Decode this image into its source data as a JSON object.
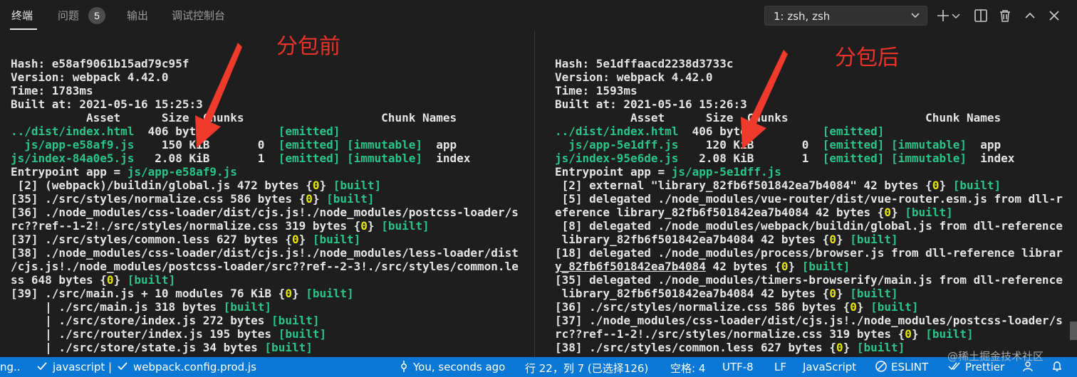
{
  "tabs": [
    {
      "label": "终端",
      "active": true
    },
    {
      "label": "问题"
    },
    {
      "label": "输出"
    },
    {
      "label": "调试控制台"
    }
  ],
  "problems_count": "5",
  "terminal_selector": {
    "value": "1: zsh, zsh"
  },
  "toolbar_icons": [
    "plus-icon",
    "chevron-down-icon",
    "split-icon",
    "trash-icon",
    "chevron-up-icon",
    "close-icon"
  ],
  "annotations": {
    "left": "分包前",
    "right": "分包后"
  },
  "colors": {
    "accent_red": "#e8332a",
    "status_bar": "#0a78d4",
    "green": "#2bc48a",
    "yellow": "#e5e510"
  },
  "left_lines": [
    [
      {
        "t": "Hash: ",
        "c": "w"
      },
      {
        "t": "e58af9061b15ad79c95f",
        "c": "w"
      }
    ],
    [
      {
        "t": "Version: webpack ",
        "c": "w"
      },
      {
        "t": "4.42.0",
        "c": "w"
      }
    ],
    [
      {
        "t": "Time: ",
        "c": "w"
      },
      {
        "t": "1783",
        "c": "w"
      },
      {
        "t": "ms",
        "c": "w"
      }
    ],
    [
      {
        "t": "Built at: 2021-05-16 ",
        "c": "w"
      },
      {
        "t": "15:25:3",
        "c": "w"
      }
    ],
    [
      {
        "t": "           Asset      Size  Chunks                    Chunk Names",
        "c": "w"
      }
    ],
    [
      {
        "t": "../dist/index.html",
        "c": "g"
      },
      {
        "t": "  406 bytes          ",
        "c": "w"
      },
      {
        "t": "[emitted]",
        "c": "g"
      }
    ],
    [
      {
        "t": "  js/app-e58af9.js",
        "c": "g"
      },
      {
        "t": "    150 KiB       0  ",
        "c": "w"
      },
      {
        "t": "[emitted] [immutable]",
        "c": "g"
      },
      {
        "t": "  app",
        "c": "w"
      }
    ],
    [
      {
        "t": "js/index-84a0e5.js",
        "c": "g"
      },
      {
        "t": "   2.08 KiB       1  ",
        "c": "w"
      },
      {
        "t": "[emitted] [immutable]",
        "c": "g"
      },
      {
        "t": "  index",
        "c": "w"
      }
    ],
    [
      {
        "t": "Entrypoint app = ",
        "c": "w"
      },
      {
        "t": "js/app-e58af9.js",
        "c": "g"
      }
    ],
    [
      {
        "t": " [2] (webpack)/buildin/global.js 472 bytes {",
        "c": "w"
      },
      {
        "t": "0",
        "c": "y"
      },
      {
        "t": "} ",
        "c": "w"
      },
      {
        "t": "[built]",
        "c": "g"
      }
    ],
    [
      {
        "t": "[35] ./src/styles/normalize.css 586 bytes {",
        "c": "w"
      },
      {
        "t": "0",
        "c": "y"
      },
      {
        "t": "} ",
        "c": "w"
      },
      {
        "t": "[built]",
        "c": "g"
      }
    ],
    [
      {
        "t": "[36] ./node_modules/css-loader/dist/cjs.js!./node_modules/postcss-loader/s",
        "c": "w"
      }
    ],
    [
      {
        "t": "rc??ref--1-2!./src/styles/normalize.css 319 bytes {",
        "c": "w"
      },
      {
        "t": "0",
        "c": "y"
      },
      {
        "t": "} ",
        "c": "w"
      },
      {
        "t": "[built]",
        "c": "g"
      }
    ],
    [
      {
        "t": "[37] ./src/styles/common.less 627 bytes {",
        "c": "w"
      },
      {
        "t": "0",
        "c": "y"
      },
      {
        "t": "} ",
        "c": "w"
      },
      {
        "t": "[built]",
        "c": "g"
      }
    ],
    [
      {
        "t": "[38] ./node_modules/css-loader/dist/cjs.js!./node_modules/less-loader/dist",
        "c": "w"
      }
    ],
    [
      {
        "t": "/cjs.js!./node_modules/postcss-loader/src??ref--2-3!./src/styles/common.le",
        "c": "w"
      }
    ],
    [
      {
        "t": "ss 648 bytes {",
        "c": "w"
      },
      {
        "t": "0",
        "c": "y"
      },
      {
        "t": "} ",
        "c": "w"
      },
      {
        "t": "[built]",
        "c": "g"
      }
    ],
    [
      {
        "t": "[39] ./src/main.js + 10 modules 76 KiB {",
        "c": "w"
      },
      {
        "t": "0",
        "c": "y"
      },
      {
        "t": "} ",
        "c": "w"
      },
      {
        "t": "[built]",
        "c": "g"
      }
    ],
    [
      {
        "t": "     | ./src/main.js 318 bytes ",
        "c": "w"
      },
      {
        "t": "[built]",
        "c": "g"
      }
    ],
    [
      {
        "t": "     | ./src/store/index.js 272 bytes ",
        "c": "w"
      },
      {
        "t": "[built]",
        "c": "g"
      }
    ],
    [
      {
        "t": "     | ./src/router/index.js 195 bytes ",
        "c": "w"
      },
      {
        "t": "[built]",
        "c": "g"
      }
    ],
    [
      {
        "t": "     | ./src/store/state.js 34 bytes ",
        "c": "w"
      },
      {
        "t": "[built]",
        "c": "g"
      }
    ]
  ],
  "right_lines": [
    [
      {
        "t": "Hash: ",
        "c": "w"
      },
      {
        "t": "5e1dffaacd2238d3733c",
        "c": "w"
      }
    ],
    [
      {
        "t": "Version: webpack ",
        "c": "w"
      },
      {
        "t": "4.42.0",
        "c": "w"
      }
    ],
    [
      {
        "t": "Time: ",
        "c": "w"
      },
      {
        "t": "1593",
        "c": "w"
      },
      {
        "t": "ms",
        "c": "w"
      }
    ],
    [
      {
        "t": "Built at: 2021-05-16 ",
        "c": "w"
      },
      {
        "t": "15:26:3",
        "c": "w"
      }
    ],
    [
      {
        "t": "           Asset      Size  Chunks                    Chunk Names",
        "c": "w"
      }
    ],
    [
      {
        "t": "../dist/index.html",
        "c": "g"
      },
      {
        "t": "  406 bytes          ",
        "c": "w"
      },
      {
        "t": "[emitted]",
        "c": "g"
      }
    ],
    [
      {
        "t": "  js/app-5e1dff.js",
        "c": "g"
      },
      {
        "t": "    120 KiB       0  ",
        "c": "w"
      },
      {
        "t": "[emitted] [immutable]",
        "c": "g"
      },
      {
        "t": "  app",
        "c": "w"
      }
    ],
    [
      {
        "t": "js/index-95e6de.js",
        "c": "g"
      },
      {
        "t": "   2.08 KiB       1  ",
        "c": "w"
      },
      {
        "t": "[emitted] [immutable]",
        "c": "g"
      },
      {
        "t": "  index",
        "c": "w"
      }
    ],
    [
      {
        "t": "Entrypoint app = ",
        "c": "w"
      },
      {
        "t": "js/app-5e1dff.js",
        "c": "g"
      }
    ],
    [
      {
        "t": " [2] external \"library_82fb6f501842ea7b4084\" 42 bytes {",
        "c": "w"
      },
      {
        "t": "0",
        "c": "y"
      },
      {
        "t": "} ",
        "c": "w"
      },
      {
        "t": "[built]",
        "c": "g"
      }
    ],
    [
      {
        "t": " [5] delegated ./node_modules/vue-router/dist/vue-router.esm.js from dll-r",
        "c": "w"
      }
    ],
    [
      {
        "t": "eference library_82fb6f501842ea7b4084 42 bytes {",
        "c": "w"
      },
      {
        "t": "0",
        "c": "y"
      },
      {
        "t": "} ",
        "c": "w"
      },
      {
        "t": "[built]",
        "c": "g"
      }
    ],
    [
      {
        "t": " [8] delegated ./node_modules/webpack/buildin/global.js from dll-reference",
        "c": "w"
      }
    ],
    [
      {
        "t": " library_82fb6f501842ea7b4084 42 bytes {",
        "c": "w"
      },
      {
        "t": "0",
        "c": "y"
      },
      {
        "t": "} ",
        "c": "w"
      },
      {
        "t": "[built]",
        "c": "g"
      }
    ],
    [
      {
        "t": "[18] delegated ./node_modules/process/browser.js from dll-reference librar",
        "c": "w"
      }
    ],
    [
      {
        "t": "y_82fb6f501842ea7b4084",
        "c": "wu"
      },
      {
        "t": " 42 bytes {",
        "c": "w"
      },
      {
        "t": "0",
        "c": "y"
      },
      {
        "t": "} ",
        "c": "w"
      },
      {
        "t": "[built]",
        "c": "g"
      }
    ],
    [
      {
        "t": "[35] delegated ./node_modules/timers-browserify/main.js from dll-reference",
        "c": "w"
      }
    ],
    [
      {
        "t": " library_82fb6f501842ea7b4084 42 bytes {",
        "c": "w"
      },
      {
        "t": "0",
        "c": "y"
      },
      {
        "t": "} ",
        "c": "w"
      },
      {
        "t": "[built]",
        "c": "g"
      }
    ],
    [
      {
        "t": "[36] ./src/styles/normalize.css 586 bytes {",
        "c": "w"
      },
      {
        "t": "0",
        "c": "y"
      },
      {
        "t": "} ",
        "c": "w"
      },
      {
        "t": "[built]",
        "c": "g"
      }
    ],
    [
      {
        "t": "[37] ./node_modules/css-loader/dist/cjs.js!./node_modules/postcss-loader/s",
        "c": "w"
      }
    ],
    [
      {
        "t": "rc??ref--1-2!./src/styles/normalize.css 319 bytes {",
        "c": "w"
      },
      {
        "t": "0",
        "c": "y"
      },
      {
        "t": "} ",
        "c": "w"
      },
      {
        "t": "[built]",
        "c": "g"
      }
    ],
    [
      {
        "t": "[38] ./src/styles/common.less 627 bytes {",
        "c": "w"
      },
      {
        "t": "0",
        "c": "y"
      },
      {
        "t": "} ",
        "c": "w"
      },
      {
        "t": "[built]",
        "c": "g"
      }
    ]
  ],
  "statusbar": {
    "lint_left": "ng..",
    "item_javascript": "javascript |",
    "item_webpack": "webpack.config.prod.js",
    "git_blame": "You, seconds ago",
    "cursor": "行 22，列 7 (已选择126)",
    "indent": "空格: 4",
    "encoding": "UTF-8",
    "eol": "LF",
    "language": "JavaScript",
    "eslint": "ESLINT",
    "prettier": "Prettier"
  },
  "watermark": "@稀土掘金技术社区"
}
